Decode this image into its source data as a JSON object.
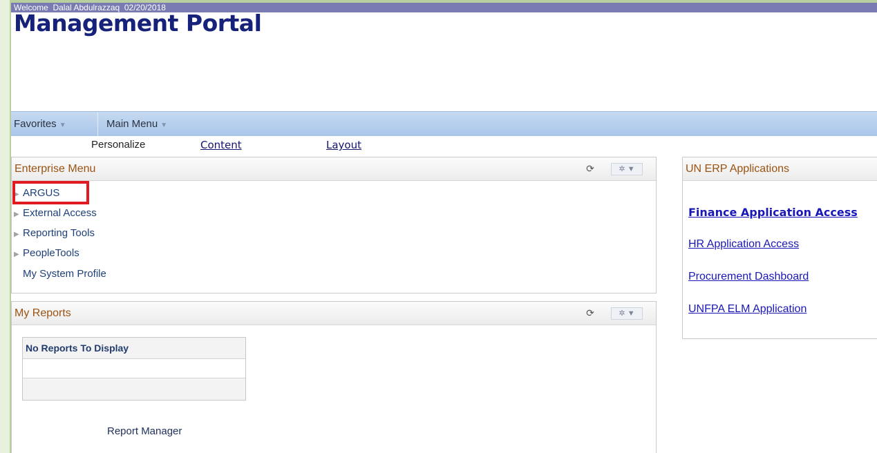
{
  "header": {
    "welcome_text": "Welcome  Dalal Abdulrazzaq  02/20/2018",
    "portal_title": "Management Portal"
  },
  "menubar": {
    "items": [
      {
        "label": "Favorites"
      },
      {
        "label": "Main Menu"
      }
    ]
  },
  "personalize": {
    "label": "Personalize",
    "content_link": "Content",
    "layout_link": "Layout"
  },
  "enterprise_menu": {
    "title": "Enterprise Menu",
    "items": [
      {
        "label": "ARGUS",
        "expandable": true
      },
      {
        "label": "External Access",
        "expandable": true
      },
      {
        "label": "Reporting Tools",
        "expandable": true
      },
      {
        "label": "PeopleTools",
        "expandable": true
      },
      {
        "label": "My System Profile",
        "expandable": false
      }
    ]
  },
  "my_reports": {
    "title": "My Reports",
    "table_header": "No Reports To Display",
    "report_manager_link": "Report Manager"
  },
  "un_erp": {
    "title": "UN ERP Applications",
    "links": [
      {
        "label": "Finance Application Access",
        "bold": true
      },
      {
        "label": "HR Application Access",
        "bold": false
      },
      {
        "label": "Procurement Dashboard",
        "bold": false
      },
      {
        "label": "UNFPA ELM Application",
        "bold": false
      }
    ]
  },
  "icons": {
    "refresh": "refresh-icon",
    "settings": "gear-icon",
    "expand": "triangle-right-icon",
    "dropdown": "caret-down-icon"
  },
  "colors": {
    "welcome_bar": "#7b7bb3",
    "title": "#16227a",
    "menubar": "#b5cfee",
    "pagelet_title": "#9a5312",
    "link": "#1a17b8",
    "highlight": "#e11b22"
  }
}
